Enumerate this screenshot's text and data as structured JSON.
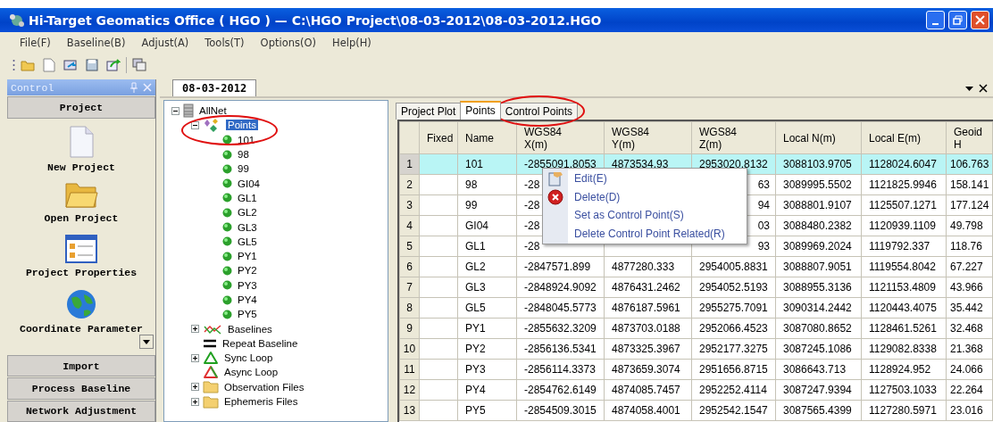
{
  "window": {
    "title": "Hi-Target Geomatics Office ( HGO ) — C:\\HGO Project\\08-03-2012\\08-03-2012.HGO"
  },
  "menu": [
    "File(F)",
    "Baseline(B)",
    "Adjust(A)",
    "Tools(T)",
    "Options(O)",
    "Help(H)"
  ],
  "toolbar": [
    {
      "kind": "open"
    },
    {
      "kind": "new"
    },
    {
      "kind": "import"
    },
    {
      "kind": "save"
    },
    {
      "kind": "export"
    },
    {
      "kind": "windows"
    }
  ],
  "control_panel": {
    "title": "Control",
    "sections": [
      {
        "label": "Project",
        "items": [
          {
            "label": "New Project",
            "kind": "new"
          },
          {
            "label": "Open Project",
            "kind": "open"
          },
          {
            "label": "Project Properties",
            "kind": "properties"
          },
          {
            "label": "Coordinate Parameter",
            "kind": "globe"
          }
        ]
      },
      {
        "label": "Import"
      },
      {
        "label": "Process Baseline"
      },
      {
        "label": "Network Adjustment"
      }
    ]
  },
  "document": {
    "tab": "08-03-2012",
    "tree": [
      {
        "label": "AllNet",
        "kind": "net",
        "expanded": true,
        "selected": false,
        "children": [
          {
            "label": "Points",
            "kind": "points",
            "expanded": true,
            "selected": true,
            "highlighted": true,
            "children": [
              {
                "label": "101",
                "kind": "point"
              },
              {
                "label": "98",
                "kind": "point"
              },
              {
                "label": "99",
                "kind": "point"
              },
              {
                "label": "GI04",
                "kind": "point"
              },
              {
                "label": "GL1",
                "kind": "point"
              },
              {
                "label": "GL2",
                "kind": "point"
              },
              {
                "label": "GL3",
                "kind": "point"
              },
              {
                "label": "GL5",
                "kind": "point"
              },
              {
                "label": "PY1",
                "kind": "point"
              },
              {
                "label": "PY2",
                "kind": "point"
              },
              {
                "label": "PY3",
                "kind": "point"
              },
              {
                "label": "PY4",
                "kind": "point"
              },
              {
                "label": "PY5",
                "kind": "point"
              }
            ]
          },
          {
            "label": "Baselines",
            "kind": "baselines",
            "expanded": false,
            "selected": false
          },
          {
            "label": "Repeat Baseline",
            "kind": "repeat",
            "selected": false
          },
          {
            "label": "Sync Loop",
            "kind": "sync",
            "expanded": false,
            "selected": false
          },
          {
            "label": "Async Loop",
            "kind": "async",
            "selected": false
          },
          {
            "label": "Observation Files",
            "kind": "folder",
            "expanded": false,
            "selected": false
          },
          {
            "label": "Ephemeris Files",
            "kind": "folder",
            "expanded": false,
            "selected": false
          }
        ]
      }
    ],
    "view_tabs": [
      {
        "label": "Project Plot",
        "selected": false,
        "highlighted": false
      },
      {
        "label": "Points",
        "selected": true,
        "highlighted": false
      },
      {
        "label": "Control Points",
        "selected": false,
        "highlighted": true
      }
    ],
    "grid": {
      "columns": [
        "Fixed",
        "Name",
        "WGS84\nX(m)",
        "WGS84\nY(m)",
        "WGS84\nZ(m)",
        "Local N(m)",
        "Local E(m)",
        "Geoid H"
      ],
      "rows": [
        {
          "number": "1",
          "selected": true,
          "cells": [
            "",
            "101",
            "-2855091.8053",
            "4873534.93",
            "2953020.8132",
            "3088103.9705",
            "1128024.6047",
            "106.763"
          ]
        },
        {
          "number": "2",
          "selected": false,
          "cells": [
            "",
            "98",
            "-28",
            null,
            "63",
            "3089995.5502",
            "1121825.9946",
            "158.141"
          ]
        },
        {
          "number": "3",
          "selected": false,
          "cells": [
            "",
            "99",
            "-28",
            null,
            "94",
            "3088801.9107",
            "1125507.1271",
            "177.124"
          ]
        },
        {
          "number": "4",
          "selected": false,
          "cells": [
            "",
            "GI04",
            "-28",
            null,
            "03",
            "3088480.2382",
            "1120939.1109",
            "49.798"
          ]
        },
        {
          "number": "5",
          "selected": false,
          "cells": [
            "",
            "GL1",
            "-28",
            null,
            "93",
            "3089969.2024",
            "1119792.337",
            "118.76"
          ]
        },
        {
          "number": "6",
          "selected": false,
          "cells": [
            "",
            "GL2",
            "-2847571.899",
            "4877280.333",
            "2954005.8831",
            "3088807.9051",
            "1119554.8042",
            "67.227"
          ]
        },
        {
          "number": "7",
          "selected": false,
          "cells": [
            "",
            "GL3",
            "-2848924.9092",
            "4876431.2462",
            "2954052.5193",
            "3088955.3136",
            "1121153.4809",
            "43.966"
          ]
        },
        {
          "number": "8",
          "selected": false,
          "cells": [
            "",
            "GL5",
            "-2848045.5773",
            "4876187.5961",
            "2955275.7091",
            "3090314.2442",
            "1120443.4075",
            "35.442"
          ]
        },
        {
          "number": "9",
          "selected": false,
          "cells": [
            "",
            "PY1",
            "-2855632.3209",
            "4873703.0188",
            "2952066.4523",
            "3087080.8652",
            "1128461.5261",
            "32.468"
          ]
        },
        {
          "number": "10",
          "selected": false,
          "cells": [
            "",
            "PY2",
            "-2856136.5341",
            "4873325.3967",
            "2952177.3275",
            "3087245.1086",
            "1129082.8338",
            "21.368"
          ]
        },
        {
          "number": "11",
          "selected": false,
          "cells": [
            "",
            "PY3",
            "-2856114.3373",
            "4873659.3074",
            "2951656.8715",
            "3086643.713",
            "1128924.952",
            "24.066"
          ]
        },
        {
          "number": "12",
          "selected": false,
          "cells": [
            "",
            "PY4",
            "-2854762.6149",
            "4874085.7457",
            "2952252.4114",
            "3087247.9394",
            "1127503.1033",
            "22.264"
          ]
        },
        {
          "number": "13",
          "selected": false,
          "cells": [
            "",
            "PY5",
            "-2854509.3015",
            "4874058.4001",
            "2952542.1547",
            "3087565.4399",
            "1127280.5971",
            "23.016"
          ]
        }
      ]
    },
    "context_menu": {
      "items": [
        {
          "label": "Edit(E)",
          "kind": "edit"
        },
        {
          "label": "Delete(D)",
          "kind": "delete"
        },
        {
          "label": "Set as Control Point(S)",
          "kind": "plain"
        },
        {
          "label": "Delete Control Point Related(R)",
          "kind": "plain"
        }
      ]
    }
  }
}
